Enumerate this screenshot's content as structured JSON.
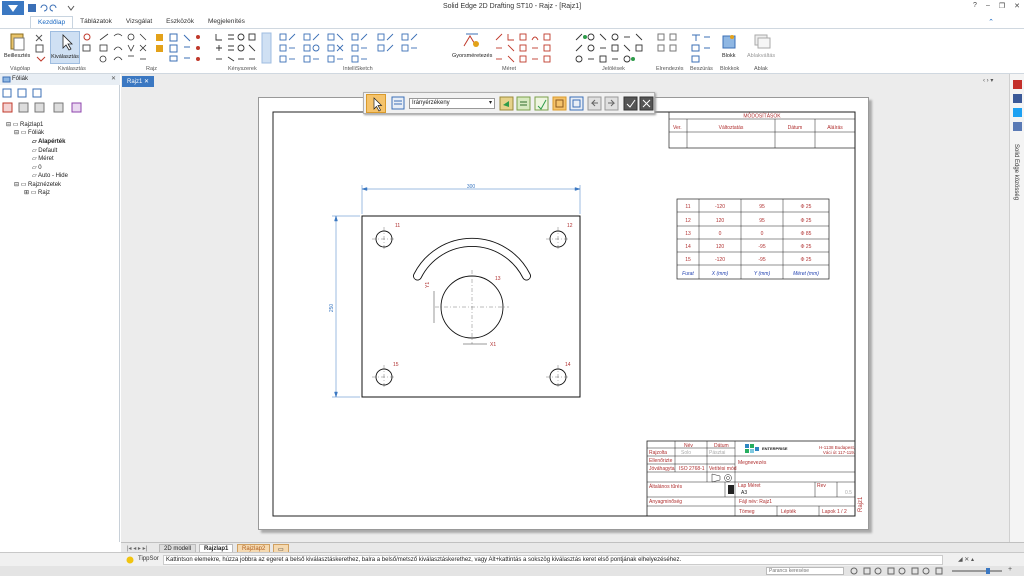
{
  "app": {
    "title": "Solid Edge 2D Drafting ST10 - Rajz - [Rajz1]",
    "window_controls": [
      "?",
      "–",
      "❐",
      "✕"
    ]
  },
  "tabs": [
    {
      "label": "Kezdőlap",
      "active": true
    },
    {
      "label": "Táblázatok",
      "active": false
    },
    {
      "label": "Vizsgálat",
      "active": false
    },
    {
      "label": "Eszközök",
      "active": false
    },
    {
      "label": "Megjelenítés",
      "active": false
    }
  ],
  "ribbon": {
    "groups": [
      "Vágólap",
      "Kiválasztás",
      "Rajz",
      "Kényszerek",
      "IntelliSketch",
      "Méret",
      "Jelölések",
      "Elrendezés",
      "Beszúrás",
      "Blokkok",
      "Ablak"
    ],
    "buttons": {
      "paste": "Beillesztés",
      "select": "Kiválasztás",
      "dim": "Gyorsméretezés",
      "block": "Blokk",
      "window": "Ablakváltás"
    }
  },
  "leftpane": {
    "title": "Fóliák",
    "tree": [
      {
        "label": "Rajzlap1",
        "level": 0
      },
      {
        "label": "Fóliák",
        "level": 1
      },
      {
        "label": "Alapérték",
        "level": 2,
        "bold": true
      },
      {
        "label": "Default",
        "level": 2
      },
      {
        "label": "Méret",
        "level": 2
      },
      {
        "label": "0",
        "level": 2
      },
      {
        "label": "Auto - Hide",
        "level": 2
      },
      {
        "label": "Rajznézetek",
        "level": 0
      },
      {
        "label": "Rajz",
        "level": 1
      }
    ]
  },
  "document": {
    "tab": "Rajz1",
    "toolbar_select": "Irányérzékeny"
  },
  "drawing": {
    "dims": {
      "width": "300",
      "height": "250",
      "x": "X1",
      "y": "Y1"
    },
    "holes": [
      "11",
      "12",
      "13",
      "14",
      "15"
    ],
    "revision_header": "MÓDOSÍTÁSOK",
    "revision_cols": [
      "Ver.",
      "Változtatás",
      "Dátum",
      "Aláírás"
    ],
    "hole_table": {
      "rows": [
        [
          "11",
          "-120",
          "95",
          "Φ 25"
        ],
        [
          "12",
          "120",
          "95",
          "Φ 25"
        ],
        [
          "13",
          "0",
          "0",
          "Φ 85"
        ],
        [
          "14",
          "120",
          "-95",
          "Φ 25"
        ],
        [
          "15",
          "-120",
          "-95",
          "Φ 25"
        ]
      ],
      "header": [
        "Furat",
        "X (mm)",
        "Y (mm)",
        "Méret (mm)"
      ]
    },
    "titleblock": {
      "col_name": "Név",
      "col_date": "Dátum",
      "drawn": "Rajzolta",
      "drawn_name": "Solo",
      "drawn_date": "Pásztai",
      "checked": "Ellenőrizte",
      "approved": "Jóváhagyta",
      "company": "ENTERPRISE",
      "address1": "H-1138 Budapest,",
      "address2": "Váci út 117-119.",
      "title_label": "Megnevezés",
      "tolerance": "ISO 2768-1",
      "proj": "Vetítési mód",
      "size_label": "Lap Méret",
      "size_value": "A3",
      "scale_label": "Rev",
      "scale_value": "0.5",
      "general": "Általános tűrés",
      "file": "Fájl név: Rajz1",
      "material": "Anyagminőség",
      "weight": "Tömeg",
      "sheet": "Lapok 1 / 2",
      "scale": "Lépték",
      "name": "Rajz1"
    }
  },
  "sheets": [
    "2D modell",
    "Rajzlap1",
    "Rajzlap2"
  ],
  "status": {
    "label": "TippSor",
    "text": "Kattintson elemekre, húzza jobbra az egeret a belső kiválasztáskerethez, balra a belső/metsző kiválasztáskerethez, vagy Alt+kattintás a sokszög kiválasztás keret első pontjának elhelyezéséhez.",
    "search_placeholder": "Parancs keresése"
  },
  "rightbar": {
    "label": "Solid Edge közösség"
  }
}
